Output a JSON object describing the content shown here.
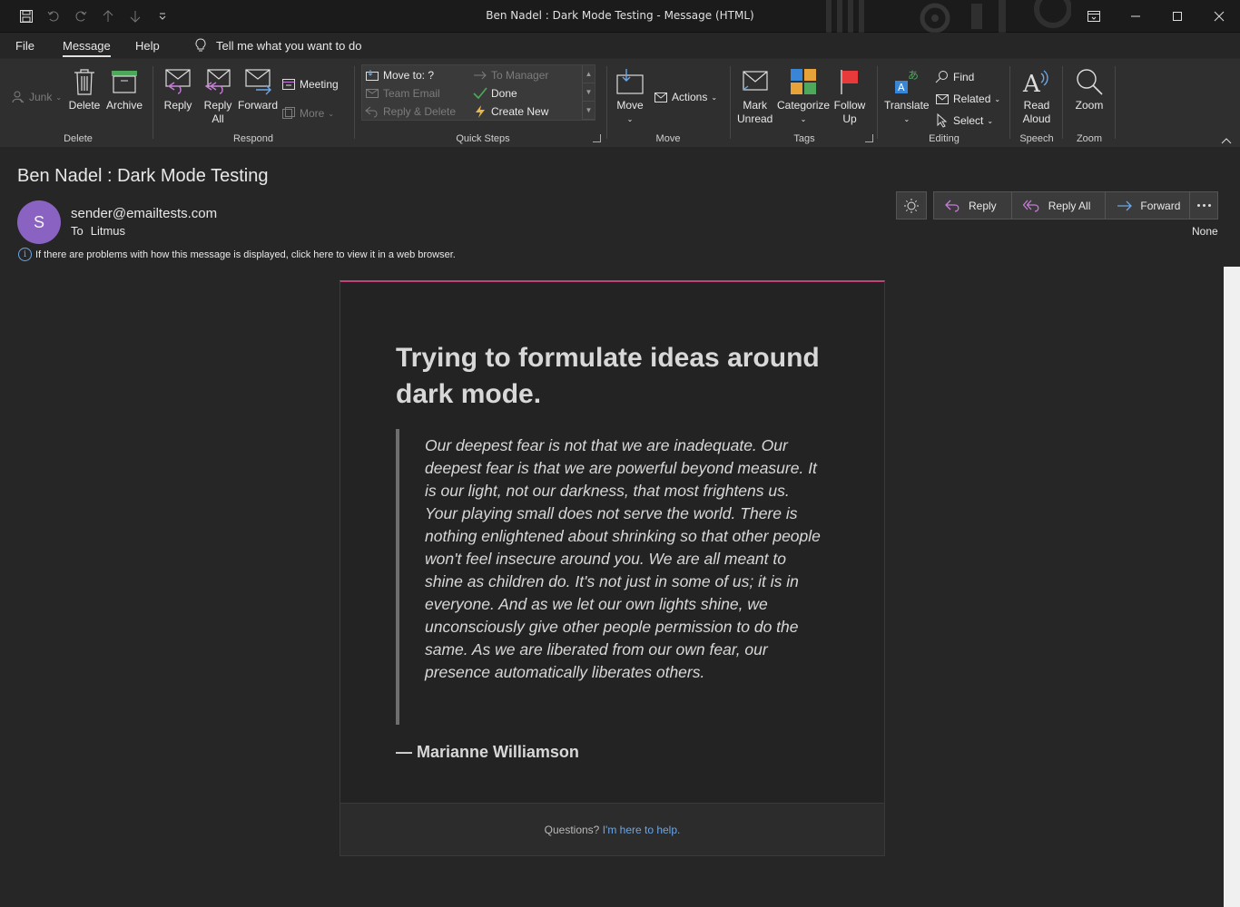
{
  "window": {
    "title": "Ben Nadel : Dark Mode Testing  -  Message (HTML)"
  },
  "menu": {
    "tabs": [
      {
        "label": "File"
      },
      {
        "label": "Message"
      },
      {
        "label": "Help"
      }
    ],
    "tell_me": "Tell me what you want to do"
  },
  "ribbon": {
    "delete_group": {
      "label": "Delete",
      "junk": "Junk",
      "delete": "Delete",
      "archive": "Archive"
    },
    "respond_group": {
      "label": "Respond",
      "reply": "Reply",
      "reply_all_1": "Reply",
      "reply_all_2": "All",
      "forward": "Forward",
      "meeting": "Meeting",
      "more": "More"
    },
    "quick_steps": {
      "label": "Quick Steps",
      "items": [
        {
          "label": "Move to: ?"
        },
        {
          "label": "To Manager"
        },
        {
          "label": "Team Email"
        },
        {
          "label": "Done"
        },
        {
          "label": "Reply & Delete"
        },
        {
          "label": "Create New"
        }
      ]
    },
    "move_group": {
      "label": "Move",
      "move": "Move",
      "actions": "Actions"
    },
    "tags_group": {
      "label": "Tags",
      "mark_unread_1": "Mark",
      "mark_unread_2": "Unread",
      "categorize": "Categorize",
      "follow_up_1": "Follow",
      "follow_up_2": "Up"
    },
    "editing_group": {
      "label": "Editing",
      "translate": "Translate",
      "find": "Find",
      "related": "Related",
      "select": "Select"
    },
    "speech_group": {
      "label": "Speech",
      "read_aloud_1": "Read",
      "read_aloud_2": "Aloud"
    },
    "zoom_group": {
      "label": "Zoom",
      "zoom": "Zoom"
    }
  },
  "message": {
    "subject": "Ben Nadel : Dark Mode Testing",
    "avatar_initial": "S",
    "sender": "sender@emailtests.com",
    "to_label": "To",
    "to_value": "Litmus",
    "info": "If there are problems with how this message is displayed, click here to view it in a web browser.",
    "actions": {
      "reply": "Reply",
      "reply_all": "Reply All",
      "forward": "Forward",
      "importance": "None"
    }
  },
  "email": {
    "heading": "Trying to formulate ideas around dark mode.",
    "quote": "Our deepest fear is not that we are inadequate. Our deepest fear is that we are powerful beyond measure. It is our light, not our darkness, that most frightens us. Your playing small does not serve the world. There is nothing enlightened about shrinking so that other people won't feel insecure around you. We are all meant to shine as children do. It's not just in some of us; it is in everyone. And as we let our own lights shine, we unconsciously give other people permission to do the same. As we are liberated from our own fear, our presence automatically liberates others.",
    "author": "— Marianne Williamson",
    "footer_text": "Questions?",
    "footer_link": "I'm here to help."
  },
  "colors": {
    "accent": "#c2437a",
    "link": "#6ba6e6",
    "avatar": "#8a63c2",
    "reply_icon": "#c77dd7",
    "forward_icon": "#6ba6e6"
  }
}
